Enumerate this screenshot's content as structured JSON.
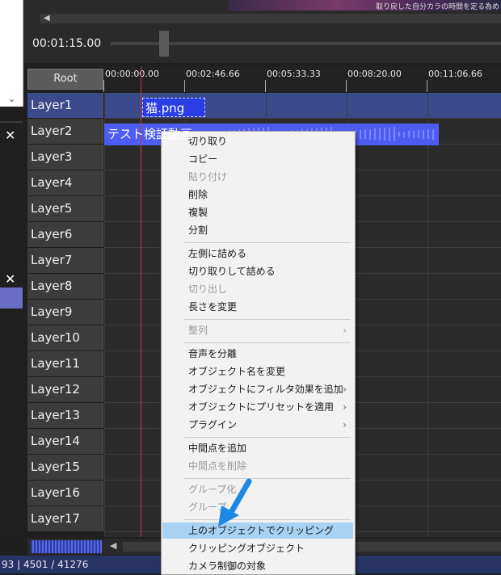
{
  "preview": {
    "caption": "取り戻した自分カラの時間を定る為め",
    "timecode": "00:01:15.00"
  },
  "timeline": {
    "root_label": "Root",
    "ruler_ticks": [
      "00:00:00.00",
      "00:02:46.66",
      "00:05:33.33",
      "00:08:20.00",
      "00:11:06.66"
    ],
    "layers": [
      "Layer1",
      "Layer2",
      "Layer3",
      "Layer4",
      "Layer5",
      "Layer6",
      "Layer7",
      "Layer8",
      "Layer9",
      "Layer10",
      "Layer11",
      "Layer12",
      "Layer13",
      "Layer14",
      "Layer15",
      "Layer16",
      "Layer17"
    ],
    "clips": {
      "png_label": "猫.png",
      "video_label": "テスト検証動画"
    }
  },
  "status": {
    "text": "93  |  4501 / 41276"
  },
  "context_menu": {
    "items": [
      {
        "label": "切り取り",
        "disabled": false
      },
      {
        "label": "コピー",
        "disabled": false
      },
      {
        "label": "貼り付け",
        "disabled": true
      },
      {
        "label": "削除",
        "disabled": false
      },
      {
        "label": "複製",
        "disabled": false
      },
      {
        "label": "分割",
        "disabled": false
      },
      {
        "label": "左側に詰める",
        "disabled": false
      },
      {
        "label": "切り取りして詰める",
        "disabled": false
      },
      {
        "label": "切り出し",
        "disabled": true
      },
      {
        "label": "長さを変更",
        "disabled": false
      },
      {
        "label": "整列",
        "disabled": true,
        "submenu": true
      },
      {
        "label": "音声を分離",
        "disabled": false
      },
      {
        "label": "オブジェクト名を変更",
        "disabled": false
      },
      {
        "label": "オブジェクトにフィルタ効果を追加",
        "disabled": false,
        "submenu": true
      },
      {
        "label": "オブジェクトにプリセットを適用",
        "disabled": false,
        "submenu": true
      },
      {
        "label": "プラグイン",
        "disabled": false,
        "submenu": true
      },
      {
        "label": "中間点を追加",
        "disabled": false
      },
      {
        "label": "中間点を削除",
        "disabled": true
      },
      {
        "label": "グループ化",
        "disabled": true
      },
      {
        "label": "グループ",
        "disabled": true
      },
      {
        "label": "上のオブジェクトでクリッピング",
        "disabled": false,
        "highlighted": true
      },
      {
        "label": "クリッピングオブジェクト",
        "disabled": false
      },
      {
        "label": "カメラ制御の対象",
        "disabled": false
      }
    ],
    "submenu_glyph": "›"
  },
  "icons": {
    "close": "✕",
    "scroll_down": "⌄",
    "scroll_left": "◀"
  },
  "colors": {
    "highlight": "#a8d2f4",
    "clip_png": "#2b3ee6",
    "clip_video": "#4f5cf2",
    "active_layer": "#3b4a8a",
    "arrow": "#1e88e5"
  }
}
